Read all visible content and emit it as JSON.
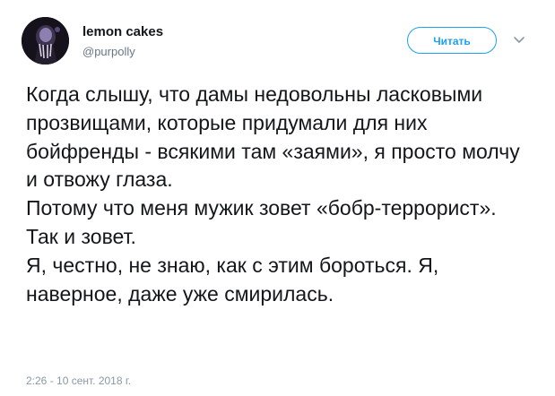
{
  "header": {
    "display_name": "lemon cakes",
    "username": "@purpolly",
    "follow_label": "Читать"
  },
  "tweet": {
    "paragraphs": [
      "Когда слышу, что дамы недовольны ласковыми прозвищами, которые придумали для них бойфренды - всякими там «заями», я просто молчу и отвожу глаза.",
      "Потому что меня мужик зовет «бобр-террорист».",
      "Так и зовет.",
      "Я, честно, не знаю, как с этим бороться. Я, наверное, даже уже смирилась."
    ],
    "timestamp": "2:26 - 10 сент. 2018 г."
  },
  "icons": {
    "avatar": "avatar-image",
    "menu": "chevron-down-icon"
  },
  "colors": {
    "accent": "#1da1f2",
    "text": "#14171a",
    "secondary": "#657786",
    "timestamp": "#8899a6"
  }
}
